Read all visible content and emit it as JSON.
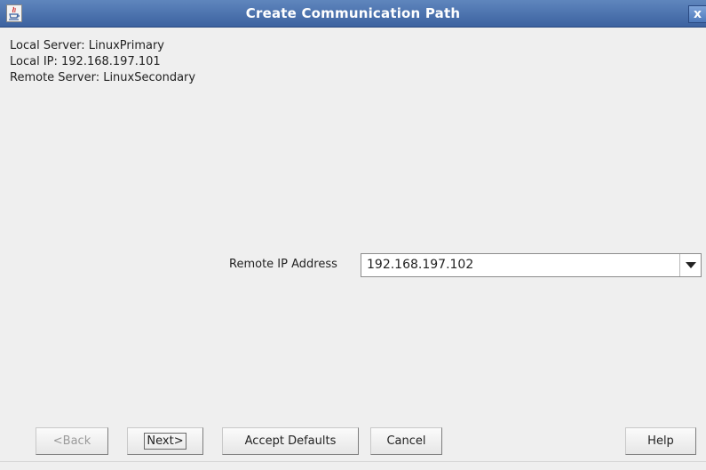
{
  "window": {
    "title": "Create Communication Path",
    "close_glyph": "x",
    "icon": "java-icon"
  },
  "info": {
    "local_server": "Local Server: LinuxPrimary",
    "local_ip": "Local IP: 192.168.197.101",
    "remote_server": "Remote Server: LinuxSecondary"
  },
  "form": {
    "remote_ip_label": "Remote IP Address",
    "remote_ip_value": "192.168.197.102",
    "dropdown_icon": "chevron-down-icon"
  },
  "buttons": {
    "back": "<Back",
    "next": "Next>",
    "accept_defaults": "Accept Defaults",
    "cancel": "Cancel",
    "help": "Help"
  },
  "colors": {
    "titlebar": "#4a71ad",
    "background": "#efefef"
  }
}
